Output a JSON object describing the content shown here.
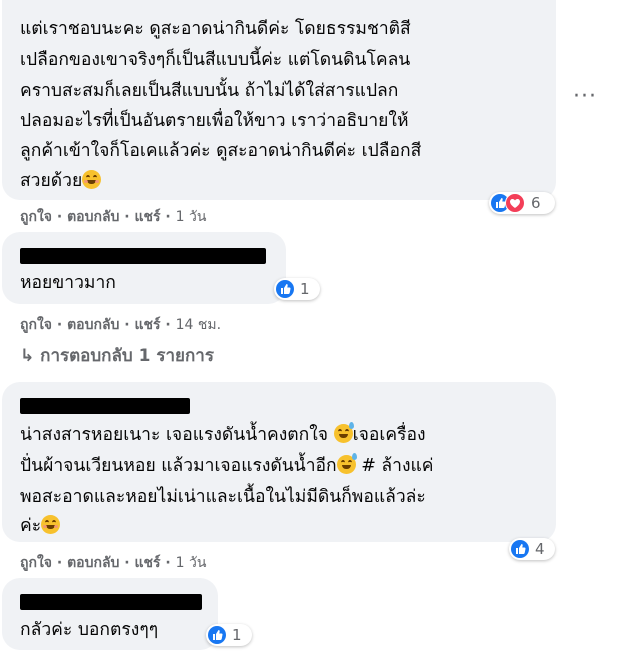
{
  "comment1": {
    "header_fragment": "ᄆᄆ ᄆᄆ",
    "lines": [
      "แต่เราชอบนะคะ ดูสะอาดน่ากินดีค่ะ โดยธรรมชาติสี",
      "เปลือกของเขาจริงๆก็เป็นสีแบบนี้ค่ะ แต่โดนดินโคลน",
      "คราบสะสมก็เลยเป็นสีแบบนั้น ถ้าไม่ได้ใส่สารแปลก",
      "ปลอมอะไรที่เป็นอันตรายเพื่อให้ขาว เราว่าอธิบายให้",
      "ลูกค้าเข้าใจก็โอเคแล้วค่ะ ดูสะอาดน่ากินดีค่ะ เปลือกสี",
      "สวยด้วย"
    ],
    "reaction_count": "6",
    "actions": {
      "like": "ถูกใจ",
      "reply": "ตอบกลับ",
      "share": "แชร์",
      "time": "1 วัน"
    }
  },
  "comment2": {
    "text": "หอยขาวมาก",
    "reaction_count": "1",
    "actions": {
      "like": "ถูกใจ",
      "reply": "ตอบกลับ",
      "share": "แชร์",
      "time": "14 ชม."
    }
  },
  "view_replies": "↳ การตอบกลับ 1 รายการ",
  "comment3": {
    "lines": [
      "น่าสงสารหอยเนาะ เจอแรงดันน้ำคงตกใจ ",
      "ปั่นผ้าจนเวียนหอย แล้วมาเจอแรงดันน้ำอีก",
      "พอสะอาดและหอยไม่เน่าและเนื้อในไม่มีดินก็พอแล้วล่ะ",
      "ค่ะ"
    ],
    "line1_tail": "เจอเครื่อง",
    "line2_tail": " # ล้างแค่",
    "reaction_count": "4",
    "actions": {
      "like": "ถูกใจ",
      "reply": "ตอบกลับ",
      "share": "แชร์",
      "time": "1 วัน"
    }
  },
  "comment4": {
    "text": "กลัวค่ะ บอกตรงๆๆ",
    "reaction_count": "1"
  },
  "colors": {
    "like": "#1877f2",
    "love": "#f33e58",
    "bubble": "#f0f2f5",
    "meta": "#65676b"
  }
}
